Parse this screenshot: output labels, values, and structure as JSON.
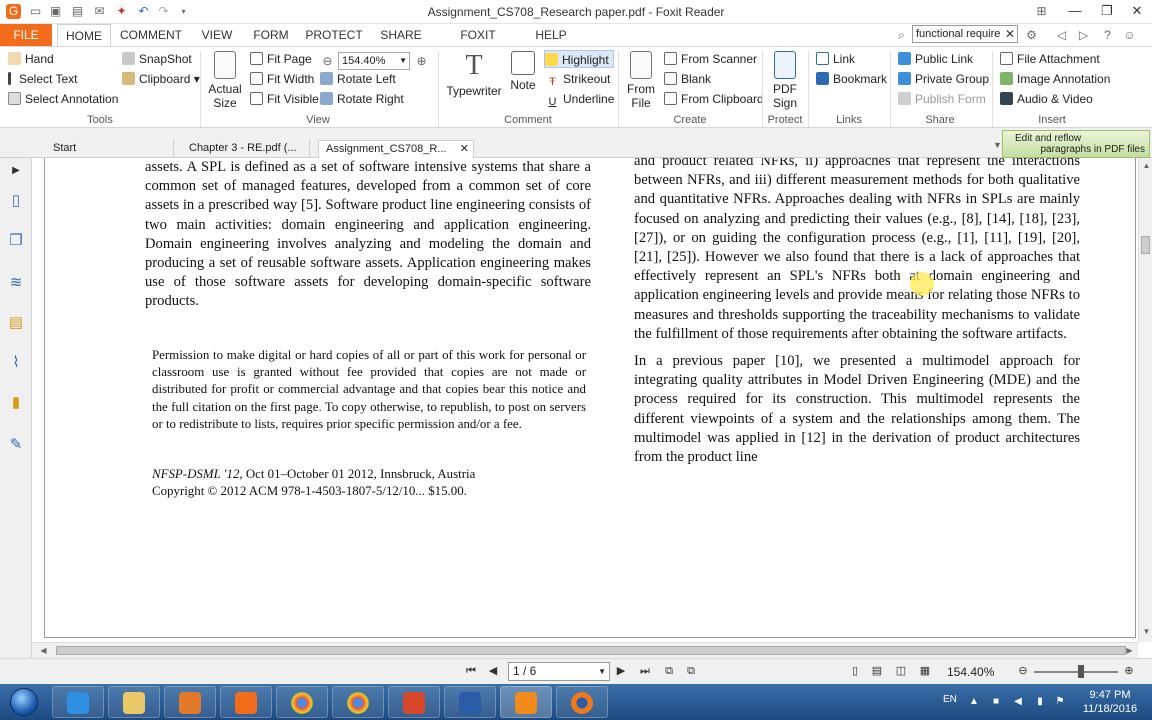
{
  "window": {
    "title": "Assignment_CS708_Research paper.pdf - Foxit Reader"
  },
  "menu": {
    "tabs": [
      "FILE",
      "HOME",
      "COMMENT",
      "VIEW",
      "FORM",
      "PROTECT",
      "SHARE",
      "FOXIT CLOUD",
      "HELP"
    ],
    "search_value": "functional require"
  },
  "ribbon": {
    "tools": {
      "hand": "Hand",
      "select_text": "Select Text",
      "select_annotation": "Select Annotation",
      "snapshot": "SnapShot",
      "clipboard": "Clipboard",
      "label": "Tools"
    },
    "view": {
      "actual_size_1": "Actual",
      "actual_size_2": "Size",
      "fit_page": "Fit Page",
      "fit_width": "Fit Width",
      "fit_visible": "Fit Visible",
      "zoom": "154.40%",
      "rotate_left": "Rotate Left",
      "rotate_right": "Rotate Right",
      "label": "View"
    },
    "comment": {
      "typewriter": "Typewriter",
      "note": "Note",
      "highlight": "Highlight",
      "strikeout": "Strikeout",
      "underline": "Underline",
      "label": "Comment"
    },
    "create": {
      "from_file_1": "From",
      "from_file_2": "File",
      "from_scanner": "From Scanner",
      "blank": "Blank",
      "from_clipboard": "From Clipboard",
      "label": "Create"
    },
    "protect": {
      "pdf_sign_1": "PDF",
      "pdf_sign_2": "Sign",
      "label": "Protect"
    },
    "links": {
      "link": "Link",
      "bookmark": "Bookmark",
      "label": "Links"
    },
    "share": {
      "public_link": "Public Link",
      "private_group": "Private Group",
      "publish_form": "Publish Form",
      "label": "Share"
    },
    "insert": {
      "file_attachment": "File Attachment",
      "image_annotation": "Image Annotation",
      "audio_video": "Audio & Video",
      "label": "Insert"
    }
  },
  "doc_tabs": {
    "start": "Start",
    "tab2": "Chapter 3 - RE.pdf (...",
    "tab3": "Assignment_CS708_R...",
    "reflow_1": "Edit and reflow",
    "reflow_2": "paragraphs in PDF files"
  },
  "document": {
    "left_col": "assets. A SPL is defined as a set of software intensive systems that share a common set of managed features, developed from a common set of core assets in a prescribed way [5]. Software product line engineering consists of two main activities: domain engineering and application engineering. Domain engineering involves analyzing and modeling the domain and producing a set of reusable software assets. Application engineering makes use of those software assets for developing domain-specific software products.",
    "permission": "Permission to make digital or hard copies of all or part of this work for personal or classroom use is granted without fee provided that copies are not made or distributed for profit or commercial advantage and that copies bear this notice and the full citation on the first page. To copy otherwise, to republish, to post on servers or to redistribute to lists, requires prior specific permission and/or a fee.",
    "conf_name": "NFSP-DSML '12",
    "conf_rest": ", Oct 01–October 01 2012, Innsbruck, Austria",
    "copyright": "Copyright © 2012 ACM 978-1-4503-1807-5/12/10... $15.00.",
    "right_p1": "and product related NFRs, ii) approaches that represent the interactions between NFRs, and iii) different measurement methods for both qualitative and quantitative NFRs. Approaches dealing with NFRs in SPLs are mainly focused on analyzing and predicting their values (e.g., [8], [14], [18], [23], [27]), or on guiding the configuration process (e.g., [1], [11], [19], [20], [21], [25]). However we also found that there is a lack of approaches that effectively represent an SPL's NFRs both at domain engineering and application engineering levels and provide means for relating those NFRs to measures and thresholds supporting the traceability mechanisms to validate the fulfillment of those requirements after obtaining the software artifacts.",
    "right_p2": "In a previous paper [10], we presented a multimodel approach for integrating quality attributes in Model Driven Engineering (MDE) and the process required for its construction. This multimodel represents the different viewpoints of a system and the relationships among them. The multimodel was applied in [12] in the derivation of product architectures from the product line"
  },
  "statusbar": {
    "page": "1 / 6",
    "zoom": "154.40%"
  },
  "taskbar": {
    "lang": "EN",
    "time": "9:47 PM",
    "date": "11/18/2016"
  },
  "colors": {
    "file_tab": "#f26c1b",
    "accent": "#2d6cb5",
    "taskbar": "#1c4a80",
    "highlight": "#ffeb50"
  }
}
